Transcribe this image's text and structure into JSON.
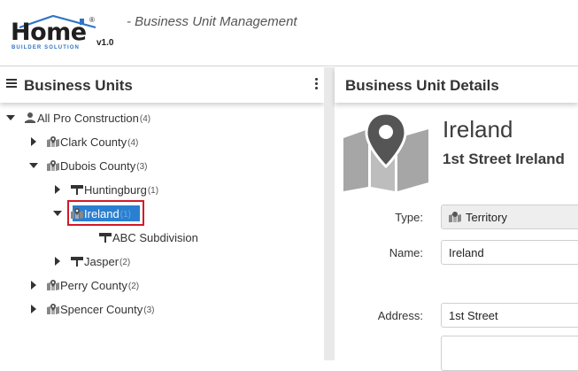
{
  "header": {
    "logo_word": "Home",
    "logo_sub": "BUILDER SOLUTION",
    "logo_reg": "®",
    "version": "v1.0",
    "subtitle": "- Business Unit Management"
  },
  "left_panel": {
    "title": "Business Units",
    "tree": [
      {
        "label": "All Pro Construction",
        "count": "(4)",
        "icon": "people-icon",
        "expanded": true
      },
      {
        "label": "Clark County",
        "count": "(4)",
        "icon": "map-icon",
        "expanded": false
      },
      {
        "label": "Dubois County",
        "count": "(3)",
        "icon": "map-icon",
        "expanded": true
      },
      {
        "label": "Huntingburg",
        "count": "(1)",
        "icon": "signpost-icon",
        "expanded": false
      },
      {
        "label": "Ireland",
        "count": "(1)",
        "icon": "map-icon",
        "expanded": true,
        "selected": true
      },
      {
        "label": "ABC Subdivision",
        "count": "",
        "icon": "signpost-icon",
        "expanded": null
      },
      {
        "label": "Jasper",
        "count": "(2)",
        "icon": "signpost-icon",
        "expanded": false
      },
      {
        "label": "Perry County",
        "count": "(2)",
        "icon": "map-icon",
        "expanded": false
      },
      {
        "label": "Spencer County",
        "count": "(3)",
        "icon": "map-icon",
        "expanded": false
      }
    ]
  },
  "right_panel": {
    "title": "Business Unit Details",
    "unit_name": "Ireland",
    "unit_address": "1st Street Ireland",
    "fields": {
      "type_label": "Type:",
      "type_value": "Territory",
      "name_label": "Name:",
      "name_value": "Ireland",
      "address_label": "Address:",
      "address_value": "1st Street",
      "address2_value": ""
    }
  },
  "colors": {
    "selection_blue": "#2a7fd1",
    "selection_outline": "#d11a2a",
    "logo_blue": "#2d74c4",
    "map_gray": "#a6a6a6"
  }
}
